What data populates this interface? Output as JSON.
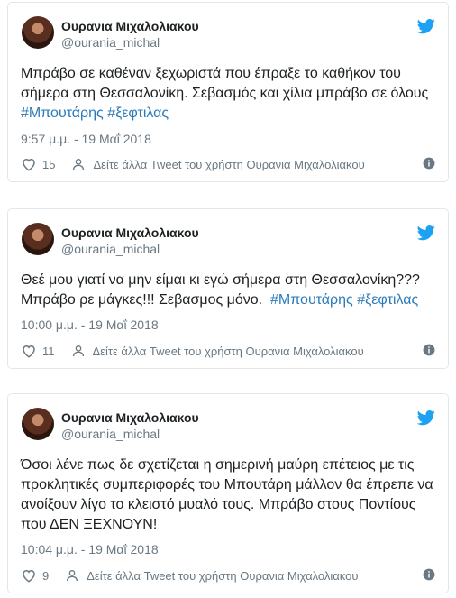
{
  "tweets": [
    {
      "name": "Ουρανια Μιχαλολιακου",
      "handle": "@ourania_michal",
      "text_line1": "Μπράβο σε καθέναν ξεχωριστά που έπραξε το καθήκον του",
      "text_line2": "σήμερα στη Θεσσαλονίκη. Σεβασμός και χίλια μπράβο σε όλους",
      "hashtag1": "#Μπουτάρης",
      "hashtag2": "#ξεφτιλας",
      "time": "9:57 μ.μ. - 19 Μαΐ 2018",
      "likes": "15",
      "see_more": "Δείτε άλλα Tweet του χρήστη Ουρανια Μιχαλολιακου"
    },
    {
      "name": "Ουρανια Μιχαλολιακου",
      "handle": "@ourania_michal",
      "text_line1": "Θεέ μου γιατί να μην είμαι κι εγώ σήμερα στη Θεσσαλονίκη???",
      "text_line2": "Μπράβο ρε μάγκες!!! Σεβασμος μόνο.",
      "hashtag1": "#Μπουτάρης",
      "hashtag2": "#ξεφτιλας",
      "time": "10:00 μ.μ. - 19 Μαΐ 2018",
      "likes": "11",
      "see_more": "Δείτε άλλα Tweet του χρήστη Ουρανια Μιχαλολιακου"
    },
    {
      "name": "Ουρανια Μιχαλολιακου",
      "handle": "@ourania_michal",
      "text_line1": "Όσοι λένε πως δε σχετίζεται η σημερινή μαύρη επέτειος με τις",
      "text_line2": "προκλητικές συμπεριφορές του Μπουτάρη μάλλον θα έπρεπε να",
      "text_line3": "ανοίξουν λίγο το κλειστό μυαλό τους. Μπράβο στους Ποντίους",
      "text_line4": "που ΔΕΝ ΞΕΧΝΟΥΝ!",
      "time": "10:04 μ.μ. - 19 Μαΐ 2018",
      "likes": "9",
      "see_more": "Δείτε άλλα Tweet του χρήστη Ουρανια Μιχαλολιακου"
    }
  ],
  "icons": {
    "brand": "twitter-bird-icon",
    "like": "heart-icon",
    "profile": "person-icon",
    "info": "info-icon"
  },
  "colors": {
    "twitter_blue": "#1da1f2",
    "hashtag": "#2b7bb9",
    "muted": "#697882",
    "border": "#e1e8ed"
  }
}
